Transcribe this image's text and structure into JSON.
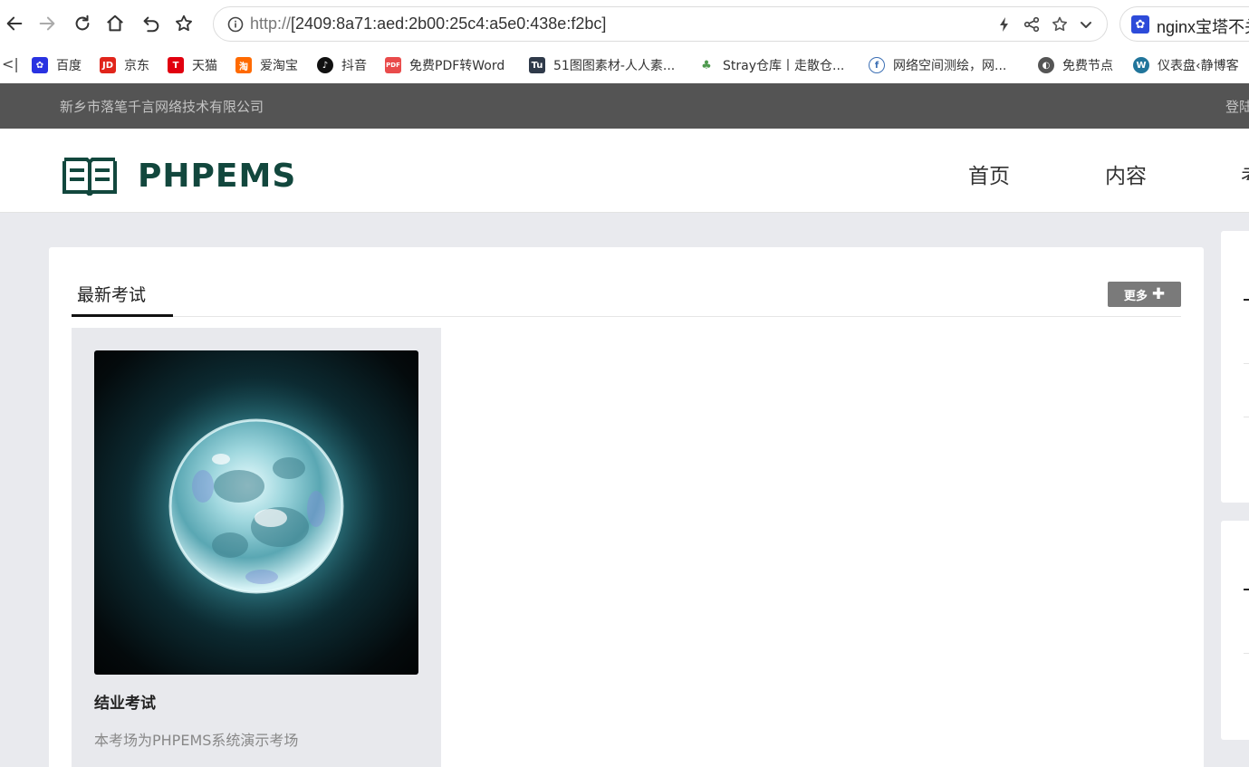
{
  "browser": {
    "url_protocol": "http://",
    "url_host": "[2409:8a71:aed:2b00:25c4:a5e0:438e:f2bc]",
    "side_tab_title": "nginx宝塔不关"
  },
  "bookmarks": {
    "items": [
      {
        "label": "百度",
        "icon": "baidu-paw-icon",
        "color": "#2932e1"
      },
      {
        "label": "京东",
        "icon": "jd-icon",
        "color": "#e1251b"
      },
      {
        "label": "天猫",
        "icon": "tmall-icon",
        "color": "#e1000f"
      },
      {
        "label": "爱淘宝",
        "icon": "taobao-icon",
        "color": "#ff6a00"
      },
      {
        "label": "抖音",
        "icon": "douyin-icon",
        "color": "#111111"
      },
      {
        "label": "免费PDF转Word",
        "icon": "pdf-icon",
        "color": "#e94b4b"
      },
      {
        "label": "51图图素材-人人素...",
        "icon": "tu-icon",
        "color": "#2f3a4a"
      },
      {
        "label": "Stray仓库丨走散仓...",
        "icon": "stray-icon",
        "color": "#4f9a4f"
      },
      {
        "label": "网络空间测绘，网...",
        "icon": "fofa-icon",
        "color": "#3c6fb4"
      },
      {
        "label": "免费节点",
        "icon": "globe-icon",
        "color": "#555555"
      },
      {
        "label": "仪表盘‹静博客",
        "icon": "wordpress-icon",
        "color": "#21759b"
      }
    ]
  },
  "site": {
    "company": "新乡市落笔千言网络技术有限公司",
    "login": "登陆",
    "logo_text": "PHPEMS",
    "brand_color": "#12473d",
    "nav": [
      "首页",
      "内容",
      "考"
    ]
  },
  "main": {
    "section_title": "最新考试",
    "more_label": "更多",
    "exam": {
      "title": "结业考试",
      "description": "本考场为PHPEMS系统演示考场"
    }
  }
}
